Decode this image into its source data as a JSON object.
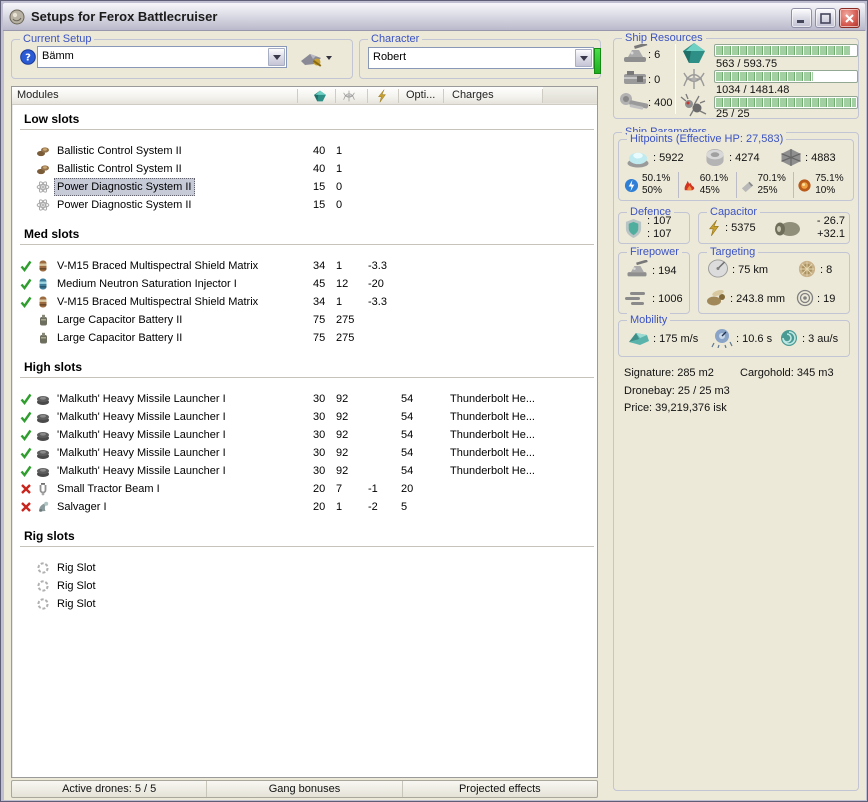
{
  "window": {
    "title": "Setups for Ferox Battlecruiser"
  },
  "setup": {
    "label": "Current Setup",
    "value": "Bämm"
  },
  "character": {
    "label": "Character",
    "value": "Robert"
  },
  "ship_resources": {
    "label": "Ship Resources",
    "turrets": ": 6",
    "launchers": ": 0",
    "calibration": ": 400",
    "bars": [
      {
        "name": "cpu",
        "text": "563 / 593.75",
        "pct": 96
      },
      {
        "name": "powergrid",
        "text": "1034 / 1481.48",
        "pct": 70
      },
      {
        "name": "dronebay",
        "text": "25 / 25",
        "pct": 100
      }
    ]
  },
  "modules": {
    "header": {
      "title": "Modules",
      "opti": "Opti...",
      "charges": "Charges"
    },
    "sections": [
      {
        "title": "Low slots",
        "rows": [
          {
            "status": "",
            "icon": "ballistic-control",
            "name": "Ballistic Control System II",
            "cpu": "40",
            "pg": "1",
            "cap": "",
            "opti": "",
            "charges": "",
            "selected": false
          },
          {
            "status": "",
            "icon": "ballistic-control",
            "name": "Ballistic Control System II",
            "cpu": "40",
            "pg": "1",
            "cap": "",
            "opti": "",
            "charges": "",
            "selected": false
          },
          {
            "status": "",
            "icon": "power-diagnostic",
            "name": "Power Diagnostic System II",
            "cpu": "15",
            "pg": "0",
            "cap": "",
            "opti": "",
            "charges": "",
            "selected": true
          },
          {
            "status": "",
            "icon": "power-diagnostic",
            "name": "Power Diagnostic System II",
            "cpu": "15",
            "pg": "0",
            "cap": "",
            "opti": "",
            "charges": "",
            "selected": false
          }
        ]
      },
      {
        "title": "Med slots",
        "rows": [
          {
            "status": "active",
            "icon": "shield-matrix",
            "name": "V-M15 Braced Multispectral Shield Matrix",
            "cpu": "34",
            "pg": "1",
            "cap": "-3.3",
            "opti": "",
            "charges": "",
            "selected": false
          },
          {
            "status": "active",
            "icon": "cap-injector",
            "name": "Medium Neutron Saturation Injector I",
            "cpu": "45",
            "pg": "12",
            "cap": "-20",
            "opti": "",
            "charges": "",
            "selected": false
          },
          {
            "status": "active",
            "icon": "shield-matrix",
            "name": "V-M15 Braced Multispectral Shield Matrix",
            "cpu": "34",
            "pg": "1",
            "cap": "-3.3",
            "opti": "",
            "charges": "",
            "selected": false
          },
          {
            "status": "",
            "icon": "cap-battery",
            "name": "Large Capacitor Battery II",
            "cpu": "75",
            "pg": "275",
            "cap": "",
            "opti": "",
            "charges": "",
            "selected": false
          },
          {
            "status": "",
            "icon": "cap-battery",
            "name": "Large Capacitor Battery II",
            "cpu": "75",
            "pg": "275",
            "cap": "",
            "opti": "",
            "charges": "",
            "selected": false
          }
        ]
      },
      {
        "title": "High slots",
        "rows": [
          {
            "status": "active",
            "icon": "missile-launcher",
            "name": "'Malkuth' Heavy Missile Launcher I",
            "cpu": "30",
            "pg": "92",
            "cap": "",
            "opti": "54",
            "charges": "Thunderbolt He...",
            "selected": false
          },
          {
            "status": "active",
            "icon": "missile-launcher",
            "name": "'Malkuth' Heavy Missile Launcher I",
            "cpu": "30",
            "pg": "92",
            "cap": "",
            "opti": "54",
            "charges": "Thunderbolt He...",
            "selected": false
          },
          {
            "status": "active",
            "icon": "missile-launcher",
            "name": "'Malkuth' Heavy Missile Launcher I",
            "cpu": "30",
            "pg": "92",
            "cap": "",
            "opti": "54",
            "charges": "Thunderbolt He...",
            "selected": false
          },
          {
            "status": "active",
            "icon": "missile-launcher",
            "name": "'Malkuth' Heavy Missile Launcher I",
            "cpu": "30",
            "pg": "92",
            "cap": "",
            "opti": "54",
            "charges": "Thunderbolt He...",
            "selected": false
          },
          {
            "status": "active",
            "icon": "missile-launcher",
            "name": "'Malkuth' Heavy Missile Launcher I",
            "cpu": "30",
            "pg": "92",
            "cap": "",
            "opti": "54",
            "charges": "Thunderbolt He...",
            "selected": false
          },
          {
            "status": "offline",
            "icon": "tractor-beam",
            "name": "Small Tractor Beam I",
            "cpu": "20",
            "pg": "7",
            "cap": "-1",
            "opti": "20",
            "charges": "",
            "selected": false
          },
          {
            "status": "offline",
            "icon": "salvager",
            "name": "Salvager I",
            "cpu": "20",
            "pg": "1",
            "cap": "-2",
            "opti": "5",
            "charges": "",
            "selected": false
          }
        ]
      },
      {
        "title": "Rig slots",
        "rows": [
          {
            "status": "",
            "icon": "rig-slot",
            "name": "Rig Slot",
            "cpu": "",
            "pg": "",
            "cap": "",
            "opti": "",
            "charges": "",
            "selected": false
          },
          {
            "status": "",
            "icon": "rig-slot",
            "name": "Rig Slot",
            "cpu": "",
            "pg": "",
            "cap": "",
            "opti": "",
            "charges": "",
            "selected": false
          },
          {
            "status": "",
            "icon": "rig-slot",
            "name": "Rig Slot",
            "cpu": "",
            "pg": "",
            "cap": "",
            "opti": "",
            "charges": "",
            "selected": false
          }
        ]
      }
    ]
  },
  "ship_parameters": {
    "label": "Ship Parameters",
    "hitpoints": {
      "label": "Hitpoints (Effective HP: 27,583)",
      "shield": ": 5922",
      "armor": ": 4274",
      "structure": ": 4883",
      "resists": [
        {
          "type": "em",
          "value": "50.1%",
          "base": "50%"
        },
        {
          "type": "thermal",
          "value": "60.1%",
          "base": "45%"
        },
        {
          "type": "kinetic",
          "value": "70.1%",
          "base": "25%"
        },
        {
          "type": "explosive",
          "value": "75.1%",
          "base": "10%"
        }
      ]
    },
    "defence": {
      "label": "Defence",
      "value1": ": 107",
      "value2": ": 107"
    },
    "capacitor": {
      "label": "Capacitor",
      "amount": ": 5375",
      "drain": "- 26.7",
      "recharge": "+32.1"
    },
    "firepower": {
      "label": "Firepower",
      "turret": ": 194",
      "missile": ": 1006"
    },
    "targeting": {
      "label": "Targeting",
      "range": ": 75 km",
      "max_targets": ": 8",
      "sig_radius": ": 243.8 mm",
      "scan_res": ": 19"
    },
    "mobility": {
      "label": "Mobility",
      "speed": ": 175 m/s",
      "align": ": 10.6 s",
      "warp": ": 3 au/s"
    },
    "stats": {
      "signature": "Signature: 285 m2",
      "cargohold": "Cargohold: 345 m3",
      "dronebay": "Dronebay: 25 / 25 m3",
      "price": "Price: 39,219,376 isk"
    }
  },
  "footer": {
    "items": [
      "Active drones: 5 / 5",
      "Gang bonuses",
      "Projected effects"
    ]
  }
}
